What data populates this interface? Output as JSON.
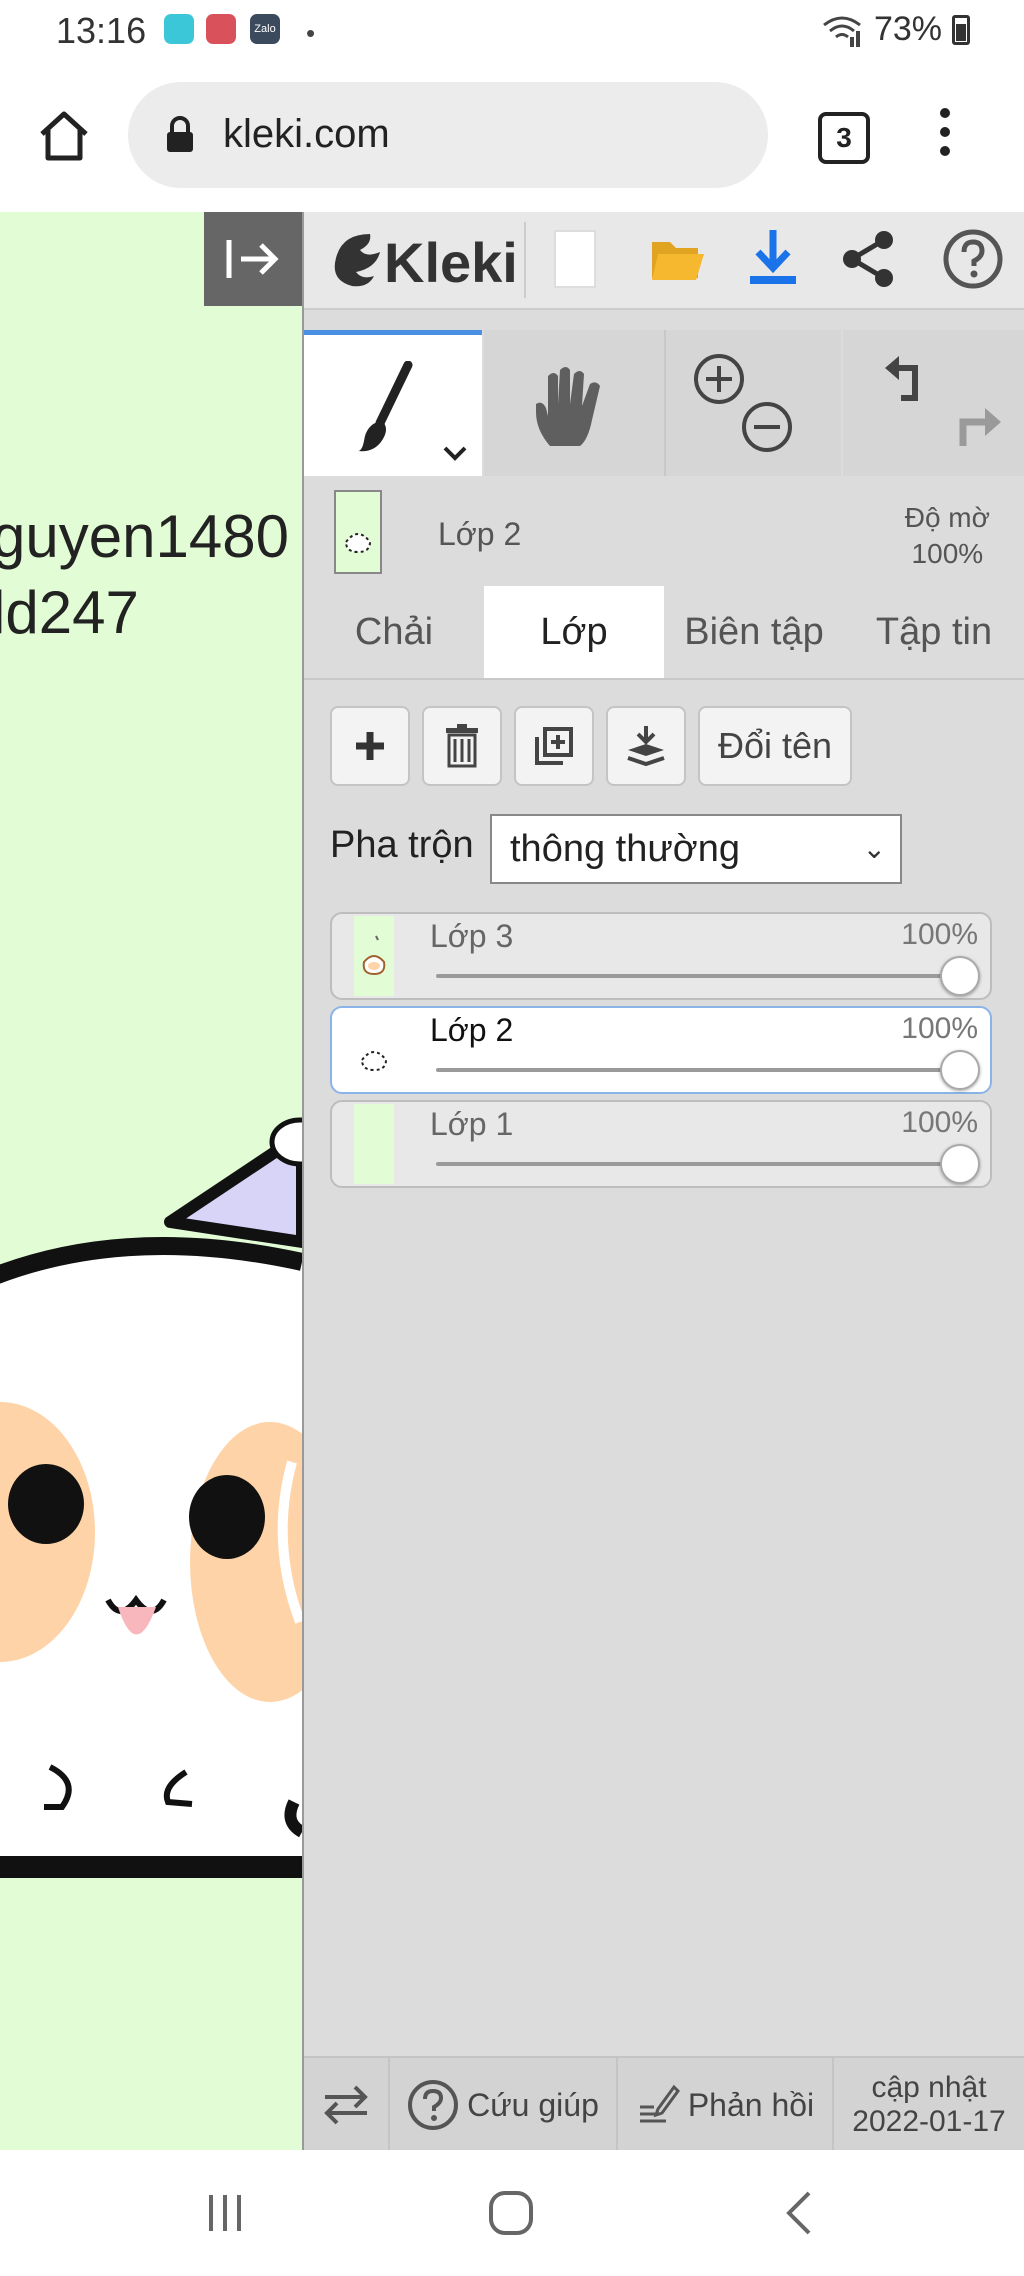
{
  "status_bar": {
    "time": "13:16",
    "app_icons": [
      "messenger-app-icon",
      "game-app-icon",
      "zalo-app-icon"
    ],
    "zalo_label": "Zalo",
    "dot": "•",
    "battery": "73%"
  },
  "browser": {
    "url": "kleki.com",
    "tab_count": "3"
  },
  "canvas": {
    "text_lines": [
      "guyen1480",
      "ld247"
    ],
    "background_color": "#e2fdd5"
  },
  "panel": {
    "logo": "Kleki",
    "current_layer": {
      "name": "Lớp 2",
      "opacity_label": "Độ mờ",
      "opacity_value": "100%"
    },
    "tabs": [
      {
        "label": "Chải",
        "active": false
      },
      {
        "label": "Lớp",
        "active": true
      },
      {
        "label": "Biên tập",
        "active": false
      },
      {
        "label": "Tập tin",
        "active": false
      }
    ],
    "layer_buttons": {
      "rename": "Đổi tên"
    },
    "blend": {
      "label": "Pha trộn",
      "value": "thông thường"
    },
    "layers": [
      {
        "name": "Lớp 3",
        "opacity": "100%",
        "opacity_fraction": 1.0,
        "active": false
      },
      {
        "name": "Lớp 2",
        "opacity": "100%",
        "opacity_fraction": 1.0,
        "active": true
      },
      {
        "name": "Lớp 1",
        "opacity": "100%",
        "opacity_fraction": 1.0,
        "active": false
      }
    ],
    "footer": {
      "help": "Cứu giúp",
      "feedback": "Phản hồi",
      "updated_label": "cập nhật",
      "updated_date": "2022-01-17"
    }
  },
  "colors": {
    "accent": "#4a90e2",
    "download": "#1a73e8",
    "folder": "#f5b82e"
  }
}
